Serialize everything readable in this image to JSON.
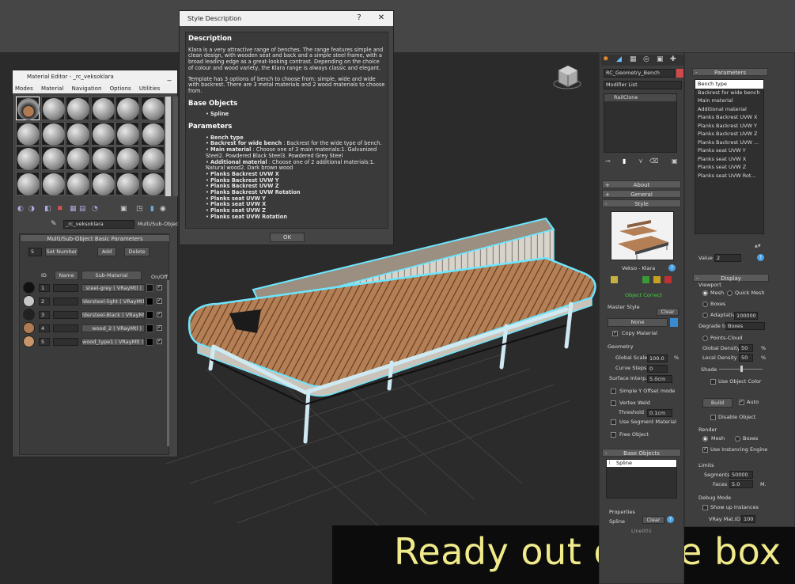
{
  "tagline": "Ready out of the box",
  "style_dialog": {
    "title": "Style Description",
    "help": "?",
    "close": "✕",
    "description_heading": "Description",
    "description_p1": "Klara is a very attractive range of benches. The range features simple and clean design, with wooden seat and back and a simple steel frame, with a broad leading edge as a great-looking contrast. Depending on the choice of colour and wood variety, the Klara range is always classic and elegant.",
    "description_p2": "Template has 3 options of bench to choose from: simple, wide and wide with backrest. There are 3 metal materials and 2 wood materials to choose from.",
    "base_objects_heading": "Base Objects",
    "base_objects": [
      "Spline"
    ],
    "parameters_heading": "Parameters",
    "params": [
      {
        "name": "Bench type",
        "desc": ""
      },
      {
        "name": "Backrest for wide bench",
        "desc": " : Backrest for the wide type of bench."
      },
      {
        "name": "Main material",
        "desc": " : Choose one of 3 main materials:1. Galvanized Steel2. Powdered Black Steel3. Powdered Grey Steel"
      },
      {
        "name": "Additional material",
        "desc": " : Choose one of 2 additional materials:1. Natural wood2. Dark brown wood"
      },
      {
        "name": "Planks Backrest UVW X",
        "desc": ""
      },
      {
        "name": "Planks Backrest UVW Y",
        "desc": ""
      },
      {
        "name": "Planks Backrest UVW Z",
        "desc": ""
      },
      {
        "name": "Planks Backrest UVW Rotation",
        "desc": ""
      },
      {
        "name": "Planks seat UVW Y",
        "desc": ""
      },
      {
        "name": "Planks seat UVW X",
        "desc": ""
      },
      {
        "name": "Planks seat UVW Z",
        "desc": ""
      },
      {
        "name": "Planks seat UVW Rotation",
        "desc": ""
      }
    ],
    "ok": "OK"
  },
  "material_editor": {
    "title": "Material Editor - _rc_veksoklara",
    "menus": [
      "Modes",
      "Material",
      "Navigation",
      "Options",
      "Utilities"
    ],
    "material_name": "_rc_veksoklara",
    "material_type": "Multi/Sub-Object",
    "rollout": "Multi/Sub-Object Basic Parameters",
    "set_count_value": "5",
    "set_number": "Set Number",
    "add": "Add",
    "delete": "Delete",
    "col_id": "ID",
    "col_name": "Name",
    "col_sub": "Sub-Material",
    "col_onoff": "On/Off",
    "rows": [
      {
        "id": "1",
        "sub": "steel-grey  ( VRayMtl )",
        "swatch": "#111111",
        "color": "#111111"
      },
      {
        "id": "2",
        "sub": "ldersteel-light  ( VRayMtl )",
        "swatch": "#c8c8c8",
        "color": "#000000"
      },
      {
        "id": "3",
        "sub": "ldersteel-Black  ( VRayMtl )",
        "swatch": "#222222",
        "color": "#000000"
      },
      {
        "id": "4",
        "sub": "wood_2  ( VRayMtl )",
        "swatch": "#b07a52",
        "color": "#000000"
      },
      {
        "id": "5",
        "sub": "wood_type1  ( VRayMtl )",
        "swatch": "#c9956a",
        "color": "#000000"
      }
    ]
  },
  "modify_panel": {
    "object_name": "RC_Geometry_Bench",
    "object_color": "#d04a4a",
    "modifier_list": "Modifier List",
    "stack_item": "RailClone",
    "about": "About",
    "general": "General",
    "style": "Style",
    "style_name": "Vekso - Klara",
    "object_correct": "Object Correct",
    "master_style": "Master Style",
    "clear": "Clear",
    "none": "None",
    "copy_material": "Copy Material",
    "geometry": "Geometry",
    "global_scale_label": "Global Scale",
    "global_scale": "100.0",
    "percent": "%",
    "curve_steps_label": "Curve Steps",
    "curve_steps": "0",
    "surface_interp_label": "Surface Interp.",
    "surface_interp": "5.0cm",
    "simple_y": "Simple Y Offset mode",
    "vertex_weld": "Vertex Weld",
    "threshold_label": "Threshold",
    "threshold": "0.1cm",
    "use_segment_material": "Use Segment Material",
    "free_object": "Free Object",
    "base_objects": "Base Objects",
    "spline_item": "Spline",
    "properties": "Properties",
    "properties_spline": "Spline",
    "properties_clear": "Clear",
    "properties_line": "Line001"
  },
  "params_panel": {
    "header": "Parameters",
    "items": [
      "Bench type",
      "Backrest for wide bench",
      "Main material",
      "Additional material",
      "Planks Backrest UVW X",
      "Planks Backrest UVW Y",
      "Planks Backrest UVW Z",
      "Planks Backrest UVW ...",
      "Planks seat UVW Y",
      "Planks seat UVW X",
      "Planks seat UVW Z",
      "Planks seat UVW Rot..."
    ],
    "value_label": "Value",
    "value": "2",
    "display": "Display",
    "viewport": "Viewport",
    "mesh": "Mesh",
    "quick_mesh": "Quick Mesh",
    "boxes": "Boxes",
    "adaptative": "Adaptative",
    "adaptative_value": "100000",
    "degrade_to": "Degrade to",
    "degrade_value": "Boxes",
    "points_cloud": "Points-Cloud",
    "global_density_label": "Global Density",
    "global_density": "50",
    "local_density_label": "Local Density",
    "local_density": "50",
    "shade": "Shade",
    "use_object_color": "Use Object Color",
    "build": "Build",
    "auto": "Auto",
    "disable_object": "Disable Object",
    "render": "Render",
    "render_mesh": "Mesh",
    "render_boxes": "Boxes",
    "use_instancing": "Use Instancing Engine",
    "limits": "Limits",
    "segments_label": "Segments",
    "segments": "50000",
    "faces_label": "Faces",
    "faces": "5.0",
    "faces_unit": "M.",
    "debug_mode": "Debug Mode",
    "show_up": "Show up Instances",
    "vray_mat_label": "VRay Mat.ID",
    "vray_mat": "100"
  }
}
